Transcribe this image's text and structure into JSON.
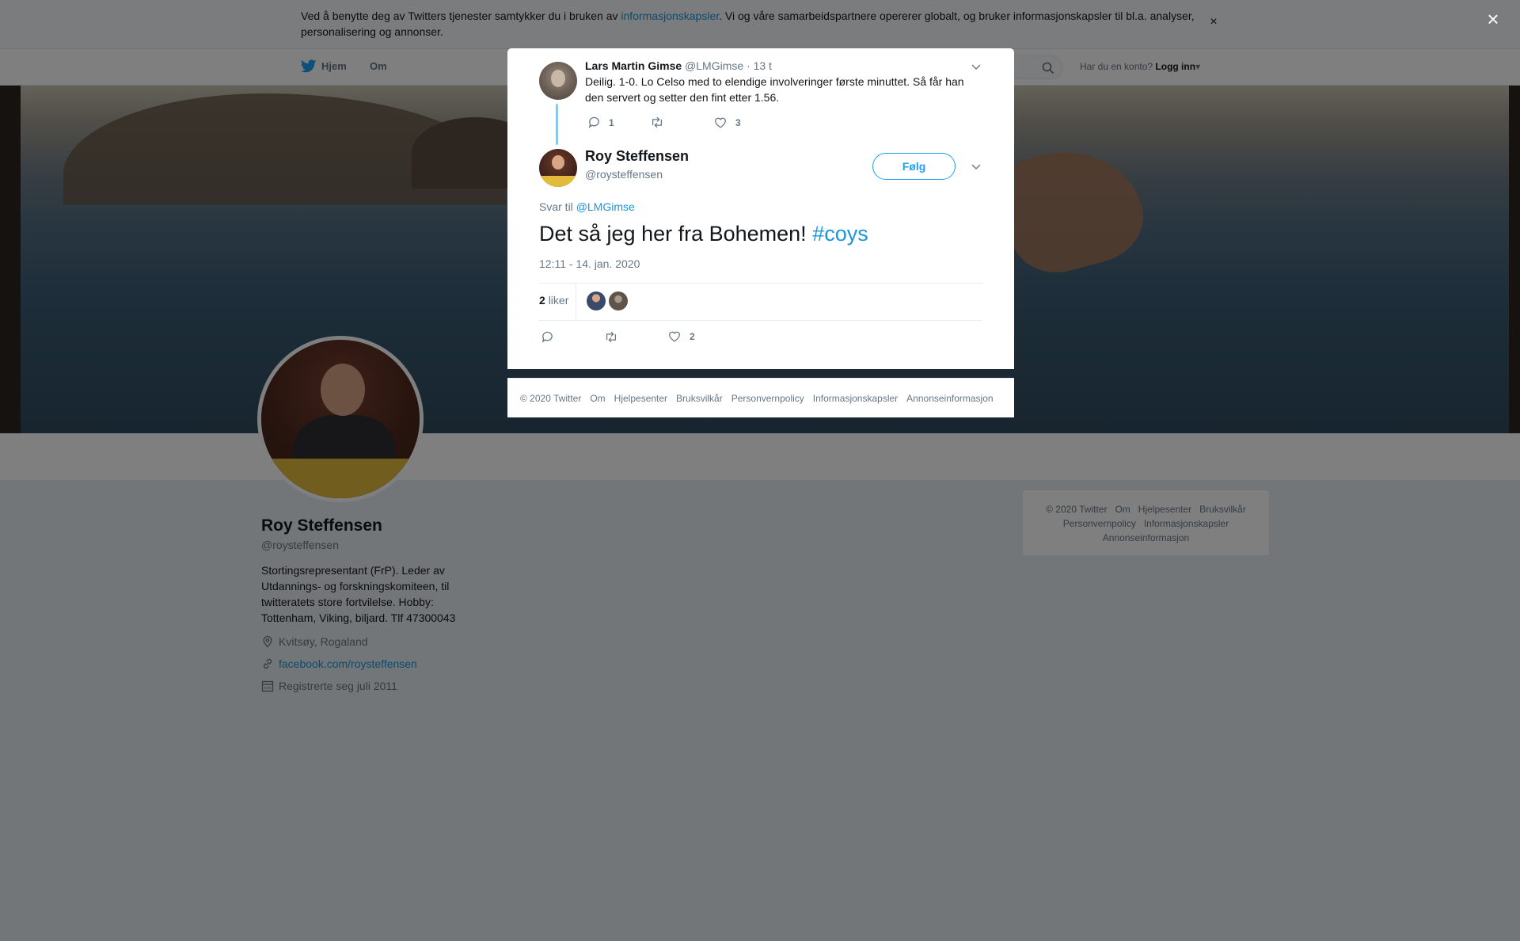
{
  "cookie_bar": {
    "text_before": "Ved å benytte deg av Twitters tjenester samtykker du i bruken av ",
    "link": "informasjonskapsler",
    "text_after": ". Vi og våre samarbeidspartnere opererer globalt, og bruker informasjonskapsler til bl.a. analyser, personalisering og annonser.",
    "close": "×"
  },
  "nav": {
    "home": "Hjem",
    "about": "Om",
    "login_prompt": "Har du en konto?",
    "login": "Logg inn"
  },
  "profile": {
    "name": "Roy Steffensen",
    "handle": "@roysteffensen",
    "bio": "Stortingsrepresentant (FrP). Leder av Utdannings- og forskningskomiteen, til twitteratets store fortvilelse. Hobby: Tottenham, Viking, biljard. Tlf 47300043",
    "location": "Kvitsøy, Rogaland",
    "website": "facebook.com/roysteffensen",
    "joined": "Registrerte seg juli 2011"
  },
  "side_footer": {
    "line1": [
      "© 2020 Twitter",
      "Om",
      "Hjelpesenter",
      "Bruksvilkår"
    ],
    "line2": [
      "Personvernpolicy",
      "Informasjonskapsler"
    ],
    "line3": [
      "Annonseinformasjon"
    ]
  },
  "modal": {
    "close": "×",
    "parent_tweet": {
      "author": "Lars Martin Gimse",
      "handle": "@LMGimse",
      "time": "· 13 t",
      "text": "Deilig. 1-0. Lo Celso med to elendige involveringer første minuttet. Så får han den servert og setter den fint etter 1.56.",
      "replies": "1",
      "retweets": "",
      "likes": "3"
    },
    "tweet": {
      "author": "Roy Steffensen",
      "handle": "@roysteffensen",
      "follow": "Følg",
      "reply_to_label": "Svar til",
      "reply_to_handle": "@LMGimse",
      "text": "Det så jeg her fra Bohemen! ",
      "hashtag": "#coys",
      "timestamp": "12:11 - 14. jan. 2020",
      "likes_count": "2",
      "likes_label": "liker",
      "action_likes": "2"
    },
    "footer": [
      "© 2020 Twitter",
      "Om",
      "Hjelpesenter",
      "Bruksvilkår",
      "Personvernpolicy",
      "Informasjonskapsler",
      "Annonseinformasjon"
    ]
  },
  "colors": {
    "accent": "#1da1f2",
    "link": "#1b95e0",
    "muted": "#657786"
  }
}
